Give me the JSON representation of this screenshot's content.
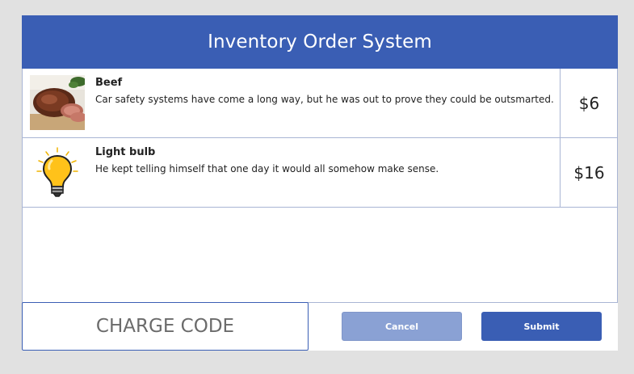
{
  "app": {
    "title": "Inventory Order System"
  },
  "items": [
    {
      "name": "Beef",
      "description": "Car safety systems have come a long way, but he was out to prove they could be outsmarted.",
      "price": "$6",
      "icon": "beef-roast-image"
    },
    {
      "name": "Light bulb",
      "description": "He kept telling himself that one day it would all somehow make sense.",
      "price": "$16",
      "icon": "light-bulb-icon"
    }
  ],
  "footer": {
    "charge_code_placeholder": "CHARGE CODE",
    "cancel_label": "Cancel",
    "submit_label": "Submit"
  },
  "colors": {
    "primary": "#3a5eb4",
    "cancel": "#8aa1d4",
    "background": "#e1e1e1"
  }
}
